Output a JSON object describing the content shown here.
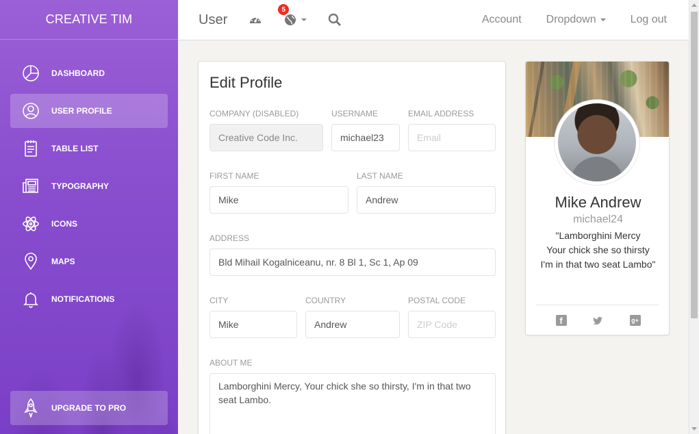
{
  "brand": "CREATIVE TIM",
  "sidebar": {
    "items": [
      {
        "label": "DASHBOARD",
        "icon": "chart-pie-icon"
      },
      {
        "label": "USER PROFILE",
        "icon": "user-circle-icon"
      },
      {
        "label": "TABLE LIST",
        "icon": "notebook-icon"
      },
      {
        "label": "TYPOGRAPHY",
        "icon": "news-paper-icon"
      },
      {
        "label": "ICONS",
        "icon": "atom-icon"
      },
      {
        "label": "MAPS",
        "icon": "map-pin-icon"
      },
      {
        "label": "NOTIFICATIONS",
        "icon": "bell-icon"
      }
    ],
    "upgrade": "UPGRADE TO PRO"
  },
  "navbar": {
    "title": "User",
    "notifications_count": "5",
    "account": "Account",
    "dropdown": "Dropdown",
    "logout": "Log out"
  },
  "form": {
    "title": "Edit Profile",
    "company_label": "COMPANY (DISABLED)",
    "company_value": "Creative Code Inc.",
    "username_label": "USERNAME",
    "username_value": "michael23",
    "email_label": "EMAIL ADDRESS",
    "email_placeholder": "Email",
    "first_name_label": "FIRST NAME",
    "first_name_value": "Mike",
    "last_name_label": "LAST NAME",
    "last_name_value": "Andrew",
    "address_label": "ADDRESS",
    "address_value": "Bld Mihail Kogalniceanu, nr. 8 Bl 1, Sc 1, Ap 09",
    "city_label": "CITY",
    "city_value": "Mike",
    "country_label": "COUNTRY",
    "country_value": "Andrew",
    "postal_label": "POSTAL CODE",
    "postal_placeholder": "ZIP Code",
    "about_label": "ABOUT ME",
    "about_value": "Lamborghini Mercy, Your chick she so thirsty, I'm in that two seat Lambo."
  },
  "profile": {
    "name": "Mike Andrew",
    "handle": "michael24",
    "quote_line1": "\"Lamborghini Mercy",
    "quote_line2": "Your chick she so thirsty",
    "quote_line3": "I'm in that two seat Lambo\""
  }
}
